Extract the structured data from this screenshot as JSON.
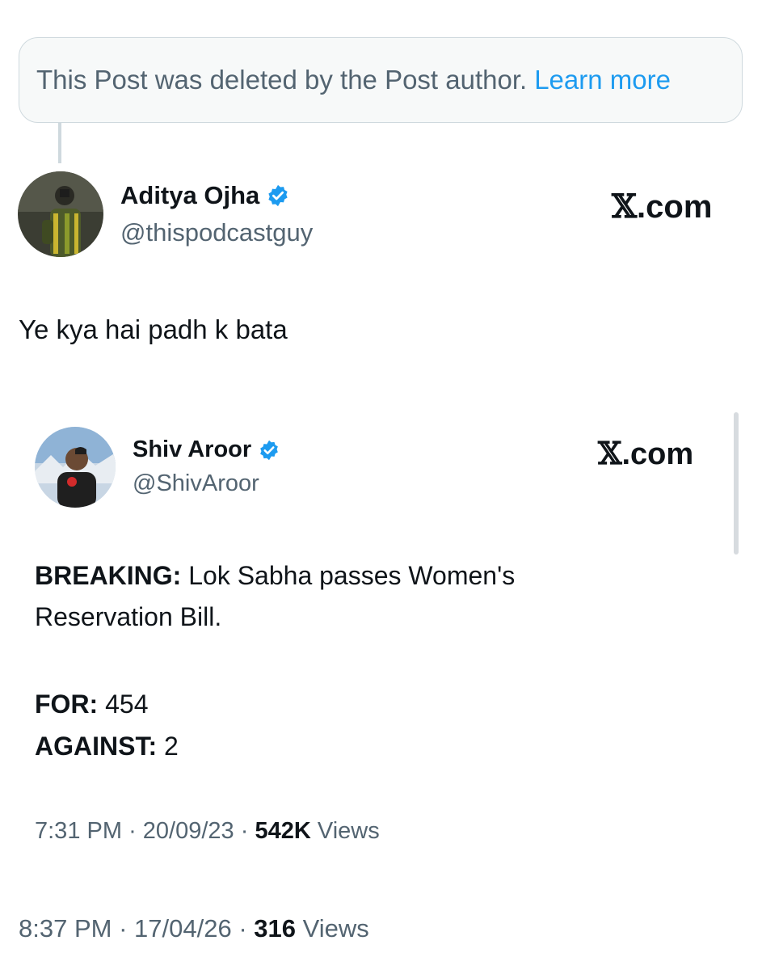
{
  "deleted_notice": {
    "text": "This Post was deleted by the Post author.",
    "link": "Learn more"
  },
  "post": {
    "author_name": "Aditya Ojha",
    "author_handle": "@thispodcastguy",
    "brand": "X.com",
    "text": "Ye kya hai padh k bata",
    "time": "8:37 PM",
    "date": "17/04/26",
    "views_count": "316",
    "views_label": "Views",
    "separator": "·"
  },
  "quoted": {
    "author_name": "Shiv Aroor",
    "author_handle": "@ShivAroor",
    "brand": "X.com",
    "line1_bold": "BREAKING:",
    "line1_rest": " Lok Sabha passes Women's",
    "line2": "Reservation Bill.",
    "for_label": "FOR:",
    "for_value": " 454",
    "against_label": "AGAINST:",
    "against_value": " 2",
    "time": "7:31 PM",
    "date": "20/09/23",
    "views_count": "542K",
    "views_label": "Views",
    "separator": "·"
  },
  "colors": {
    "verified": "#1d9bf0",
    "link": "#1d9bf0",
    "muted": "#536471",
    "text": "#0f1419"
  },
  "icons": {
    "verified": "verified-badge-icon",
    "brand": "x-logo"
  }
}
